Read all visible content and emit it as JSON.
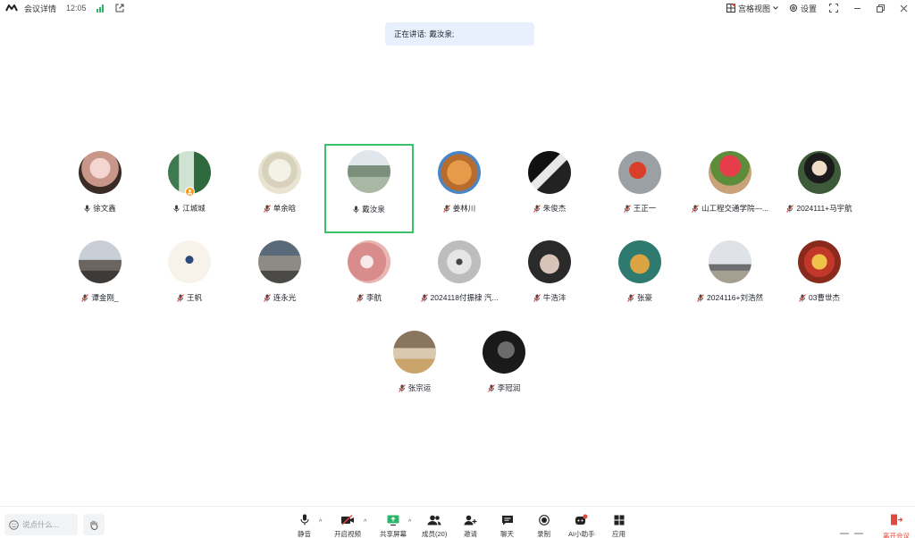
{
  "titlebar": {
    "meeting_details": "会议详情",
    "time": "12:05",
    "view_label": "宫格视图",
    "settings_label": "设置"
  },
  "speaker_banner": {
    "prefix": "正在讲话:",
    "name": "戴汝泉;"
  },
  "participants": [
    {
      "name": "徐文鑫",
      "muted": false
    },
    {
      "name": "江城城",
      "muted": false
    },
    {
      "name": "单余晗",
      "muted": true
    },
    {
      "name": "戴汝泉",
      "muted": false,
      "active": true
    },
    {
      "name": "姜林川",
      "muted": true
    },
    {
      "name": "朱俊杰",
      "muted": true
    },
    {
      "name": "王正一",
      "muted": true
    },
    {
      "name": "山工程交通学院—...",
      "muted": true
    },
    {
      "name": "2024111+马宇航",
      "muted": true
    },
    {
      "name": "谭金刚_",
      "muted": true
    },
    {
      "name": "王帆",
      "muted": true
    },
    {
      "name": "连永光",
      "muted": true
    },
    {
      "name": "李航",
      "muted": true
    },
    {
      "name": "2024118付振棣 汽...",
      "muted": true
    },
    {
      "name": "牛浩沣",
      "muted": true
    },
    {
      "name": "张豪",
      "muted": true
    },
    {
      "name": "2024116+刘浩然",
      "muted": true
    },
    {
      "name": "03曹世杰",
      "muted": true
    },
    {
      "name": "张宗运",
      "muted": true
    },
    {
      "name": "李冠润",
      "muted": true
    }
  ],
  "toolbar": {
    "chat_placeholder": "说点什么...",
    "mute": "静音",
    "video": "开启视频",
    "share": "共享屏幕",
    "members": "成员(20)",
    "invite": "邀请",
    "chat": "聊天",
    "record": "录制",
    "ai_assistant": "AI小助手",
    "apps": "应用",
    "leave": "离开会议"
  },
  "colors": {
    "active_border": "#3bc06b",
    "banner_bg": "#e8f0fe",
    "leave_red": "#e5483a",
    "signal_green": "#2fb56a",
    "muted_red": "#e5483a"
  }
}
